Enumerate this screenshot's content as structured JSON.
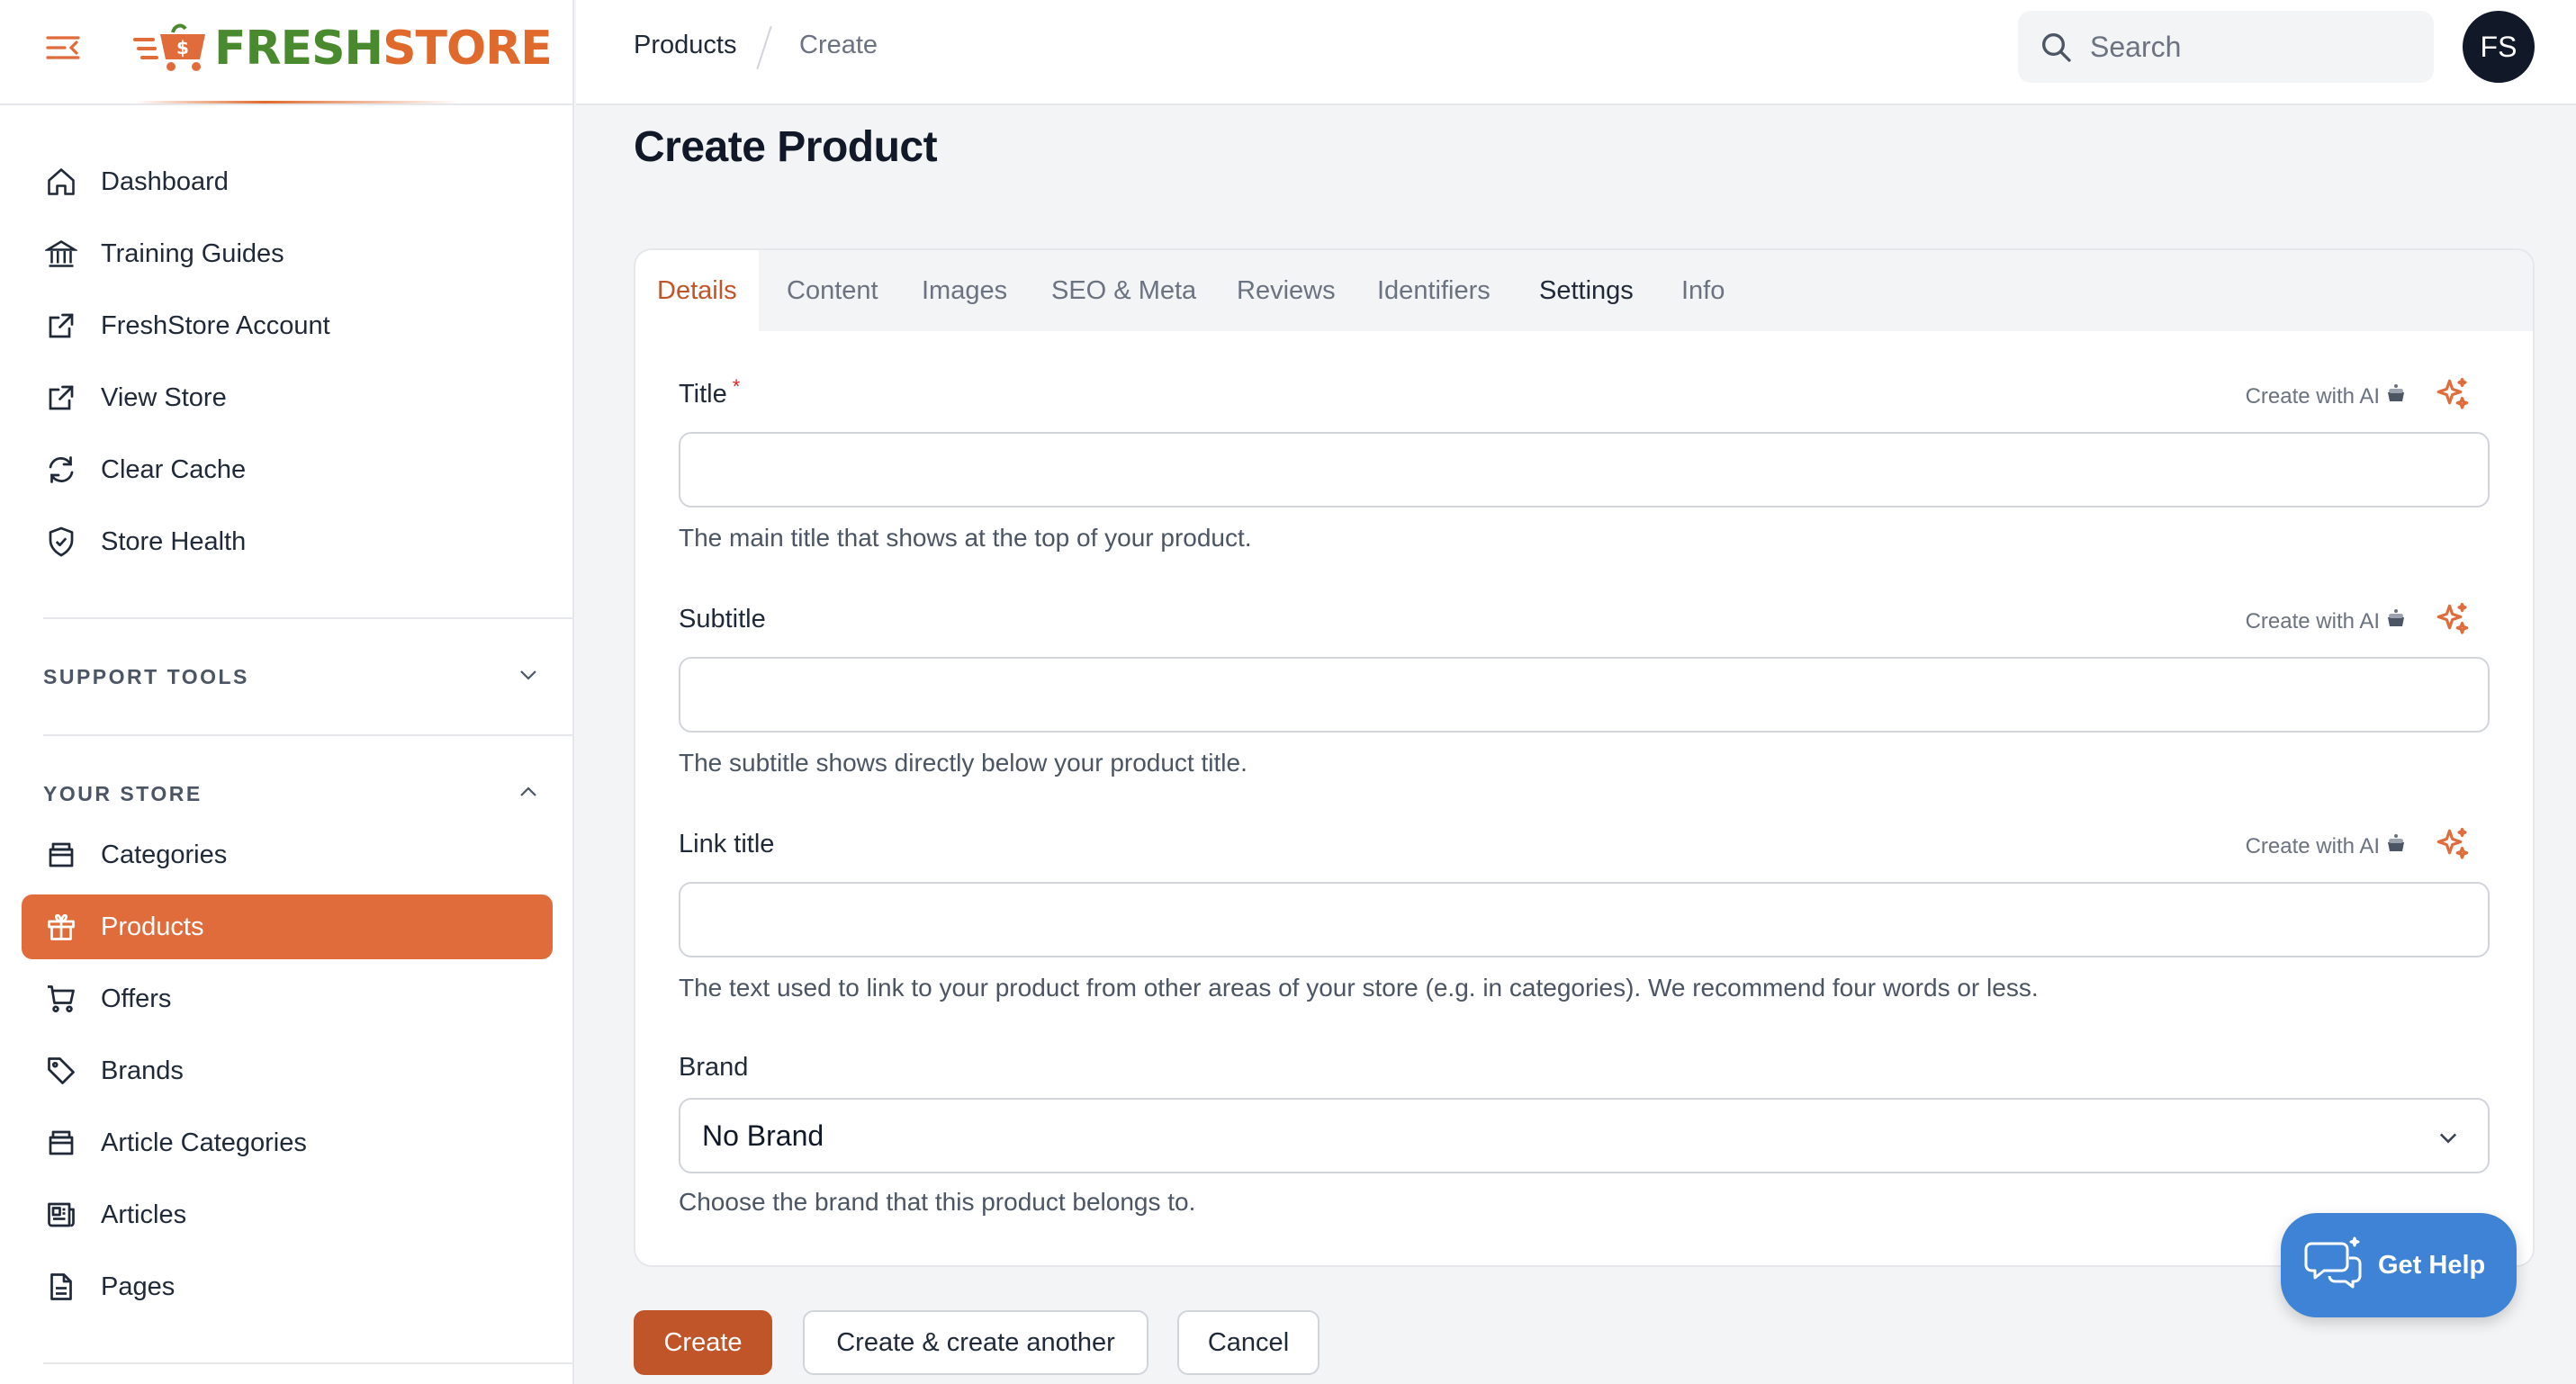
{
  "brand": {
    "part1": "FRESH",
    "part2": "STORE",
    "accent": "#e06c3c",
    "green": "#4a8a2f"
  },
  "sidebar": {
    "top_items": [
      {
        "label": "Dashboard",
        "icon": "home-icon"
      },
      {
        "label": "Training Guides",
        "icon": "building-columns-icon"
      },
      {
        "label": "FreshStore Account",
        "icon": "external-link-icon"
      },
      {
        "label": "View Store",
        "icon": "external-link-icon"
      },
      {
        "label": "Clear Cache",
        "icon": "refresh-icon"
      },
      {
        "label": "Store Health",
        "icon": "shield-check-icon"
      }
    ],
    "groups": {
      "support_tools": "SUPPORT TOOLS",
      "your_store": "YOUR STORE"
    },
    "store_items": [
      {
        "label": "Categories",
        "icon": "archive-box-icon"
      },
      {
        "label": "Products",
        "icon": "gift-icon",
        "active": true
      },
      {
        "label": "Offers",
        "icon": "shopping-cart-icon"
      },
      {
        "label": "Brands",
        "icon": "tag-icon"
      },
      {
        "label": "Article Categories",
        "icon": "archive-box-icon"
      },
      {
        "label": "Articles",
        "icon": "newspaper-icon"
      },
      {
        "label": "Pages",
        "icon": "document-icon"
      }
    ]
  },
  "topbar": {
    "breadcrumb": [
      "Products",
      "Create"
    ],
    "search_placeholder": "Search",
    "avatar_initials": "FS"
  },
  "page": {
    "title": "Create Product",
    "tabs": [
      "Details",
      "Content",
      "Images",
      "SEO & Meta",
      "Reviews",
      "Identifiers",
      "Settings",
      "Info"
    ],
    "active_tab": "Details",
    "ai_label": "Create with AI",
    "fields": {
      "title": {
        "label": "Title",
        "required_mark": "*",
        "value": "",
        "hint": "The main title that shows at the top of your product."
      },
      "subtitle": {
        "label": "Subtitle",
        "value": "",
        "hint": "The subtitle shows directly below your product title."
      },
      "link_title": {
        "label": "Link title",
        "value": "",
        "hint": "The text used to link to your product from other areas of your store (e.g. in categories). We recommend four words or less."
      },
      "brand": {
        "label": "Brand",
        "value": "No Brand",
        "hint": "Choose the brand that this product belongs to."
      }
    }
  },
  "actions": {
    "create": "Create",
    "create_another": "Create & create another",
    "cancel": "Cancel"
  },
  "help": {
    "label": "Get Help",
    "color": "#3f83d6"
  }
}
